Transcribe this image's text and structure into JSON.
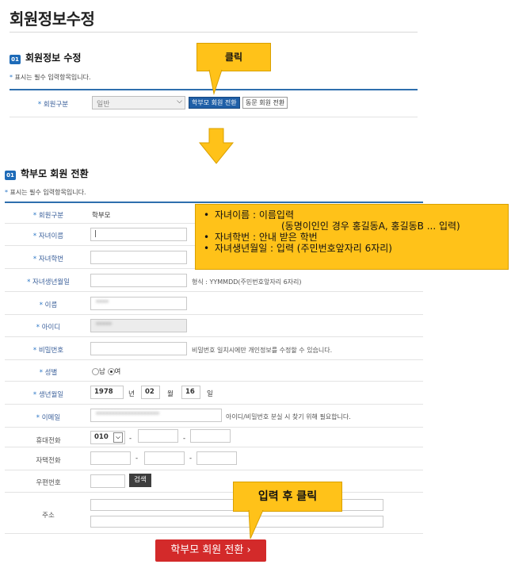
{
  "page": {
    "title": "회원정보수정"
  },
  "section1": {
    "num": "01",
    "title": "회원정보 수정",
    "required_note": "표시는 필수 입력항목입니다.",
    "member_type_label": "회원구분",
    "member_type_value": "일반",
    "btn_parent": "학부모 회원 전환",
    "btn_alumni": "동문 회원 전환",
    "callout": "클릭"
  },
  "section2": {
    "num": "01",
    "title": "학부모 회원 전환",
    "required_note": "표시는 필수 입력항목입니다.",
    "rows": {
      "member_type": {
        "label": "회원구분",
        "value": "학부모"
      },
      "child_name": {
        "label": "자녀이름",
        "value": "|"
      },
      "child_id": {
        "label": "자녀학번"
      },
      "child_birth": {
        "label": "자녀생년월일",
        "hint": "형식 : YYMMDD(주민번호앞자리 6자리)"
      },
      "name": {
        "label": "이름",
        "value": "****"
      },
      "user_id": {
        "label": "아이디",
        "value": "*****"
      },
      "password": {
        "label": "비밀번호",
        "hint": "비밀번호 일치시에만 개인정보를 수정할 수 있습니다."
      },
      "gender": {
        "label": "성별",
        "male": "남",
        "female": "여"
      },
      "birth": {
        "label": "생년월일",
        "year": "1978",
        "year_unit": "년",
        "month": "02",
        "month_unit": "월",
        "day": "16",
        "day_unit": "일"
      },
      "email": {
        "label": "이메일",
        "value": "********************",
        "hint": "아이디/비밀번호 분실 시 찾기 위해 필요합니다."
      },
      "mobile": {
        "label": "휴대전화",
        "prefix": "010",
        "sep": "-"
      },
      "home_phone": {
        "label": "자택전화",
        "sep": "-"
      },
      "postcode": {
        "label": "우편번호",
        "search_btn": "검색"
      },
      "address": {
        "label": "주소"
      }
    },
    "tips": [
      "자녀이름 : 이름입력",
      "(동명이인인 경우 홍길동A, 홍길동B ... 입력)",
      "자녀학번 : 안내 받은 학번",
      "자녀생년월일 : 입력 (주민번호앞자리 6자리)"
    ],
    "callout": "입력 후 클릭",
    "submit": "학부모 회원 전환 ›"
  },
  "colors": {
    "accent": "#ffc219",
    "primary": "#1f5fa7",
    "submit": "#d32a2a"
  },
  "icons": {
    "arrow": "down-arrow-icon",
    "select": "chevron-down-icon"
  }
}
